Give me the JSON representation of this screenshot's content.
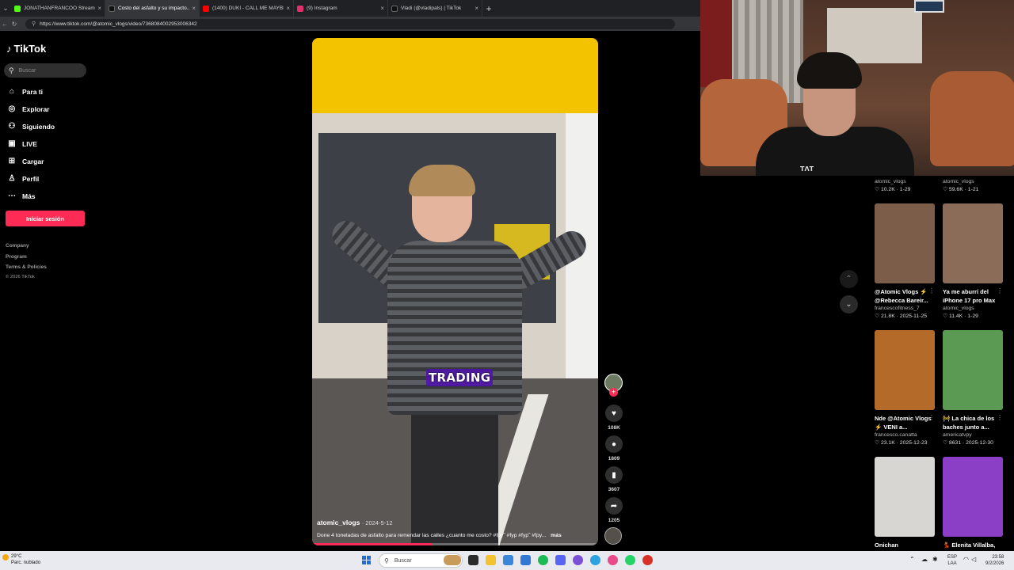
{
  "browser": {
    "tabs": [
      {
        "title": "JONATHANFRANCOO Stream - W...",
        "favicon_color": "#53fc18",
        "active": false
      },
      {
        "title": "Costo del asfalto y su impacto...",
        "favicon_color": "#111111",
        "active": true
      },
      {
        "title": "(1400) DUKI - CALL ME MAYBE (V...",
        "favicon_color": "#ff0000",
        "active": false
      },
      {
        "title": "(9) Instagram",
        "favicon_color": "#e1306c",
        "active": false
      },
      {
        "title": "Vladi (@vladipals) | TikTok",
        "favicon_color": "#111111",
        "active": false
      }
    ],
    "url": "https://www.tiktok.com/@atomic_vlogs/video/7368084002953006342"
  },
  "sidebar": {
    "logo": "TikTok",
    "search_placeholder": "Buscar",
    "items": [
      {
        "label": "Para ti",
        "icon": "home-icon"
      },
      {
        "label": "Explorar",
        "icon": "compass-icon"
      },
      {
        "label": "Siguiendo",
        "icon": "following-icon"
      },
      {
        "label": "LIVE",
        "icon": "live-icon"
      },
      {
        "label": "Cargar",
        "icon": "upload-icon"
      },
      {
        "label": "Perfil",
        "icon": "profile-icon"
      },
      {
        "label": "Más",
        "icon": "more-icon"
      }
    ],
    "login_label": "Iniciar sesión",
    "footer": [
      "Company",
      "Program",
      "Terms & Policies"
    ],
    "copyright": "© 2026 TikTok"
  },
  "video": {
    "overlay_text": "TRADING",
    "author": "atomic_vlogs",
    "date": "2024-5-12",
    "caption": "Done 4 toneladas de asfalto para remendar las calles ¿cuanto me costo? #fpy˜ #fyp #fyp˜ #fpy...",
    "more_label": "más",
    "progress": 0.42
  },
  "actions": {
    "likes": "108K",
    "comments": "1809",
    "saves": "3607",
    "shares": "1205"
  },
  "right_top": [
    {
      "account": "atomic_vlogs",
      "likes": "10.2K",
      "date": "1-29"
    },
    {
      "account": "atomic_vlogs",
      "likes": "59.6K",
      "date": "1-21"
    }
  ],
  "grid": [
    {
      "title": "@Atomic Vlogs ⚡ @Rebecca Bareir...",
      "account": "francescofitness_7",
      "likes": "21.8K",
      "date": "2025-11-25",
      "thumb": "#7c5d49"
    },
    {
      "title": "Ya me aburrí del iPhone 17 pro Max",
      "account": "atomic_vlogs",
      "likes": "11.4K",
      "date": "1-29",
      "thumb": "#8a6c58"
    },
    {
      "title": "Nde @Atomic Vlogs ⚡ VENI a...",
      "account": "francesco.canatta",
      "likes": "23.1K",
      "date": "2025-12-23",
      "thumb": "#b46b2a"
    },
    {
      "title": "🚧 La chica de los baches junto a...",
      "account": "americatvpy",
      "likes": "8631",
      "date": "2025-12-30",
      "thumb": "#5b9a52"
    },
    {
      "title": "Onichan",
      "account": "",
      "likes": "",
      "date": "",
      "thumb": "#d8d6d2"
    },
    {
      "title": "💃 Elenita Villalba,",
      "account": "",
      "likes": "",
      "date": "",
      "thumb": "#8b3fc7"
    }
  ],
  "taskbar": {
    "temp": "29°C",
    "weather": "Parc. nublado",
    "search_placeholder": "Buscar",
    "lang": "ESP",
    "region": "LAA",
    "time": "23:58",
    "date": "9/2/2026"
  }
}
